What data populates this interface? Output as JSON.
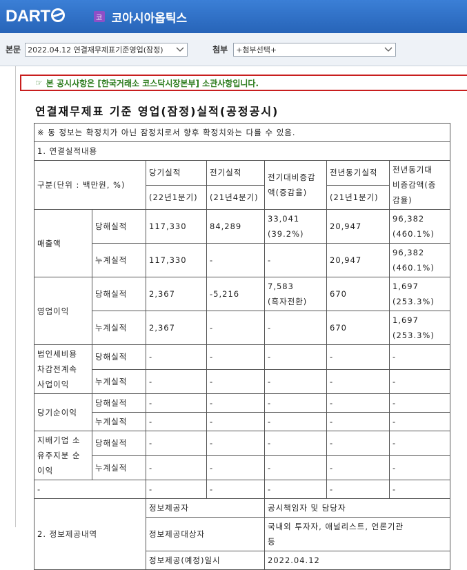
{
  "header": {
    "logo_text": "DART",
    "company_badge": "코",
    "company_name": "코아시아옵틱스"
  },
  "toolbar": {
    "doc_label": "본문",
    "doc_value": "2022.04.12  연결재무제표기준영업(잠정)",
    "attach_label": "첨부",
    "attach_value": "+첨부선택+"
  },
  "notice": {
    "text": "본 공시사항은 [한국거래소 코스닥시장본부] 소관사항입니다."
  },
  "doc_title": "연결재무제표 기준 영업(잠정)실적(공정공시)",
  "table": {
    "disclaimer": "※ 동 정보는 확정치가 아닌 잠정치로서 향후 확정치와는 다를 수 있음.",
    "section1": "1. 연결실적내용",
    "hdr_unit": "구분(단위 : 백만원, %)",
    "hdr_current": "당기실적",
    "hdr_current_sub": "(22년1분기)",
    "hdr_prev": "전기실적",
    "hdr_prev_sub": "(21년4분기)",
    "hdr_prev_change_1": "전기대비증감",
    "hdr_prev_change_2": "액(증감율)",
    "hdr_yoy": "전년동기실적",
    "hdr_yoy_sub": "(21년1분기)",
    "hdr_yoy_change_1": "전년동기대",
    "hdr_yoy_change_2": "비증감액(증",
    "hdr_yoy_change_3": "감율)",
    "sub_current": "당해실적",
    "sub_cumulative": "누계실적",
    "revenue": {
      "label": "매출액",
      "cur": {
        "current": "117,330",
        "prev": "84,289",
        "chg1": "33,041",
        "chg2": "(39.2%)",
        "yoy": "20,947",
        "yoychg1": "96,382",
        "yoychg2": "(460.1%)"
      },
      "cum": {
        "current": "117,330",
        "prev": "-",
        "chg1": "-",
        "yoy": "20,947",
        "yoychg1": "96,382",
        "yoychg2": "(460.1%)"
      }
    },
    "op_income": {
      "label": "영업이익",
      "cur": {
        "current": "2,367",
        "prev": "-5,216",
        "chg1": "7,583",
        "chg2": "(흑자전환)",
        "yoy": "670",
        "yoychg1": "1,697",
        "yoychg2": "(253.3%)"
      },
      "cum": {
        "current": "2,367",
        "prev": "-",
        "chg1": "-",
        "yoy": "670",
        "yoychg1": "1,697",
        "yoychg2": "(253.3%)"
      }
    },
    "pretax": {
      "label_1": "법인세비용",
      "label_2": "차감전계속",
      "label_3": "사업이익",
      "dash": "-"
    },
    "net_income": {
      "label": "당기순이익",
      "dash": "-"
    },
    "controlling": {
      "label_1": "지배기업 소",
      "label_2": "유주지분 순",
      "label_3": "이익",
      "dash": "-"
    },
    "misc_dash": "-",
    "section2": "2. 정보제공내역",
    "provider_label": "정보제공자",
    "provider_value": "공시책임자 및 담당자",
    "target_label": "정보제공대상자",
    "target_value_1": "국내외 투자자, 애널리스트, 언론기관",
    "target_value_2": "등",
    "date_label": "정보제공(예정)일시",
    "date_value": "2022.04.12"
  }
}
